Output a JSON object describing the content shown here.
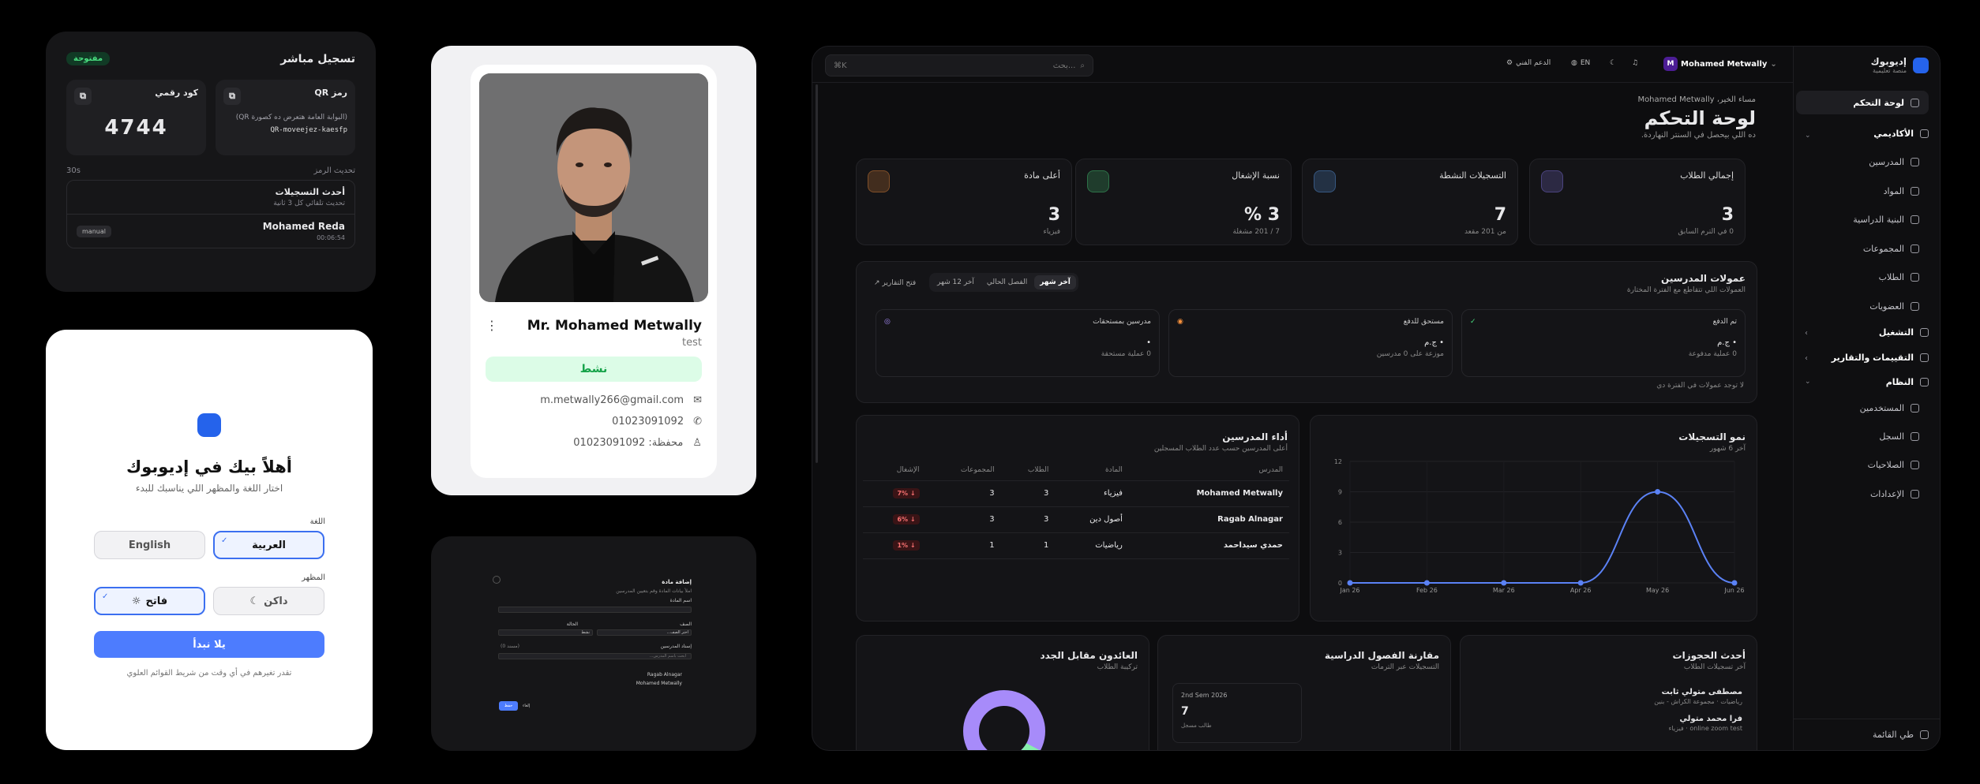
{
  "live": {
    "title": "تسجيل مباشر",
    "status": "مفتوحة",
    "digital_code_label": "كود رقمي",
    "digital_code": "4744",
    "qr_label": "رمز QR",
    "qr_hint": "(البوابة العامة هتعرض ده كصورة QR)",
    "qr_code": "QR-moveejez-kaesfp",
    "refresh_label": "تحديث الرمز",
    "refresh_value": "30s",
    "recent_title": "أحدث التسجيلات",
    "recent_sub": "تحديث تلقائي كل 3 ثانية",
    "entry_name": "Mohamed Reda",
    "entry_tag": "manual",
    "entry_time": "00:06:54"
  },
  "welcome": {
    "title": "أهلاً بيك في إديوبوك",
    "subtitle": "اختار اللغة والمظهر اللي يناسبك للبدء",
    "lang_label": "اللغة",
    "lang_ar": "العربية",
    "lang_en": "English",
    "theme_label": "المظهر",
    "theme_light": "فاتح",
    "theme_dark": "داكن",
    "start": "يلا نبدأ",
    "note": "تقدر تغيرهم في أي وقت من شريط القوائم العلوي"
  },
  "profile": {
    "name": "Mr. Mohamed Metwally",
    "role": "test",
    "status": "نشط",
    "email": "m.metwally266@gmail.com",
    "phone": "01023091092",
    "wallet": "محفظة: 01023091092"
  },
  "addsub": {
    "title": "إضافة مادة",
    "sub": "املأ بيانات المادة وقم بتعيين المدرسين",
    "name_label": "اسم المادة",
    "grade_label": "الصف",
    "grade_ph": "اختر الصف...",
    "status_label": "الحالة",
    "status_val": "نشط",
    "assign_label": "إسناد المدرسين",
    "assigned": "(مسند 0)",
    "search_ph": "ابحث باسم المدرس...",
    "t1": "Ragab Alnagar",
    "t2": "Mohamed Metwally",
    "save": "حفظ",
    "cancel": "إلغاء"
  },
  "topbar": {
    "search_ph": "بحث...",
    "shortcut": "⌘K",
    "support": "الدعم الفني",
    "lang": "EN",
    "user": "Mohamed Metwally",
    "avatar": "M"
  },
  "sidebar": {
    "brand": "إديوبوك",
    "brand_sub": "منصة تعليمية",
    "items": [
      "لوحة التحكم",
      "الأكاديمي",
      "المدرسين",
      "المواد",
      "البنية الدراسية",
      "المجموعات",
      "الطلاب",
      "العضويات",
      "التشغيل",
      "التقييمات والتقارير",
      "النظام",
      "المستخدمين",
      "السجل",
      "الصلاحيات",
      "الإعدادات"
    ],
    "footer": "طي القائمة"
  },
  "header": {
    "greeting": "مساء الخير، Mohamed Metwally",
    "title": "لوحة التحكم",
    "sub": "ده اللي بيحصل في السنتر النهاردة."
  },
  "kpis": [
    {
      "title": "إجمالي الطلاب",
      "value": "3",
      "sub": "0 في الترم السابق",
      "color": "#8b7cf6"
    },
    {
      "title": "التسجيلات النشطة",
      "value": "7",
      "sub": "من 201 مقعد",
      "color": "#60a5fa"
    },
    {
      "title": "نسبة الإشغال",
      "value": "3 %",
      "sub": "7 / 201 مشغلة",
      "color": "#4ade80"
    },
    {
      "title": "أعلى مادة",
      "value": "3",
      "sub": "فيزياء",
      "color": "#fb923c"
    }
  ],
  "commission": {
    "title": "عمولات المدرسين",
    "sub": "العمولات اللي تتقاطع مع الفترة المختارة",
    "tabs": [
      "آخر شهر",
      "الفصل الحالي",
      "آخر 12 شهر"
    ],
    "open_reports": "فتح التقارير",
    "paid_title": "تم الدفع",
    "paid_amount": "• ج.م",
    "paid_sub": "0 عملية مدفوعة",
    "due_title": "مستحق للدفع",
    "due_amount": "• ج.م",
    "due_sub": "موزعة على 0 مدرسين",
    "owed_title": "مدرسين بمستحقات",
    "owed_amount": "•",
    "owed_sub": "0 عملية مستحقة",
    "empty": "لا توجد عمولات في الفترة دي"
  },
  "perf": {
    "title": "أداء المدرسين",
    "sub": "أعلى المدرسين حسب عدد الطلاب المسجلين",
    "cols": [
      "المدرس",
      "المادة",
      "الطلاب",
      "المجموعات",
      "الإشغال"
    ],
    "rows": [
      [
        "Mohamed Metwally",
        "فيزياء",
        "3",
        "3",
        "7%"
      ],
      [
        "Ragab Alnagar",
        "أصول دين",
        "3",
        "3",
        "6%"
      ],
      [
        "حمدي سيداحمد",
        "رياضيات",
        "1",
        "1",
        "1%"
      ]
    ]
  },
  "growth": {
    "title": "نمو التسجيلات",
    "sub": "آخر 6 شهور"
  },
  "chart_data": {
    "type": "line",
    "x": [
      "Jan 26",
      "Feb 26",
      "Mar 26",
      "Apr 26",
      "May 26",
      "Jun 26"
    ],
    "series": [
      {
        "values": [
          0,
          0,
          0,
          0,
          9,
          0
        ],
        "color": "#5b82f5"
      }
    ],
    "yticks": [
      0,
      3,
      6,
      9,
      12
    ],
    "ylim": [
      0,
      12
    ],
    "grid": true
  },
  "bookings": {
    "title": "أحدث الحجوزات",
    "sub": "آخر تسجيلات الطلاب",
    "items": [
      {
        "name": "مصطفى متولي ثابت",
        "detail": "رياضيات · مجموعة الكراش - بنين"
      },
      {
        "name": "فرا محمد متولي",
        "detail": "online zoom test · فيزياء"
      }
    ]
  },
  "terms": {
    "title": "مقارنة الفصول الدراسية",
    "sub": "التسجيلات عبر الترمات",
    "term": "2nd Sem 2026",
    "value": "7",
    "label": "طالب مسجل"
  },
  "returning": {
    "title": "العائدون مقابل الجدد",
    "sub": "تركيبة الطلاب"
  }
}
